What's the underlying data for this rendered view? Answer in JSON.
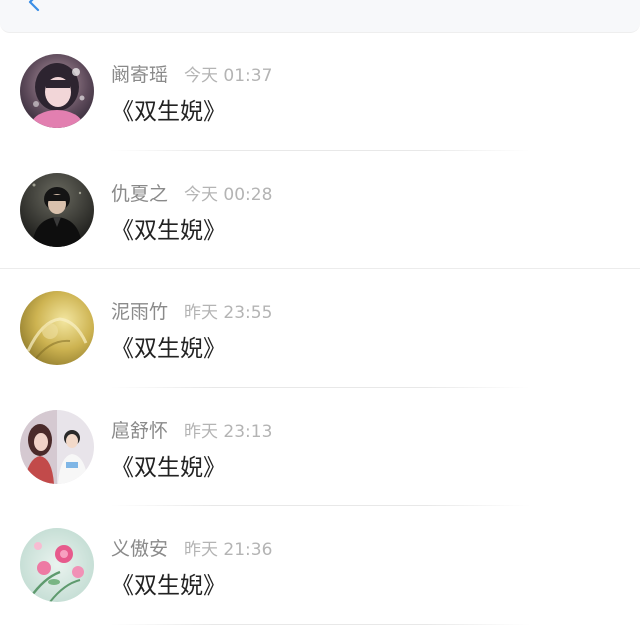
{
  "header": {
    "back_icon": "chevron-left-icon",
    "accent": "#3a8ee6"
  },
  "messages": [
    {
      "user": "阚寄瑶",
      "time": "今天 01:37",
      "text": "《双生婗》",
      "avatar_icon": "girl-portrait-avatar"
    },
    {
      "user": "仇夏之",
      "time": "今天 00:28",
      "text": "《双生婗》",
      "avatar_icon": "boy-in-black-avatar"
    },
    {
      "user": "泥雨竹",
      "time": "昨天 23:55",
      "text": "《双生婗》",
      "avatar_icon": "golden-illustration-avatar"
    },
    {
      "user": "扈舒怀",
      "time": "昨天 23:13",
      "text": "《双生婗》",
      "avatar_icon": "couple-photo-avatar"
    },
    {
      "user": "义傲安",
      "time": "昨天 21:36",
      "text": "《双生婗》",
      "avatar_icon": "pink-flowers-avatar"
    }
  ],
  "colors": {
    "name": "#8a8a8a",
    "time": "#b4b4b4",
    "message": "#222222"
  }
}
